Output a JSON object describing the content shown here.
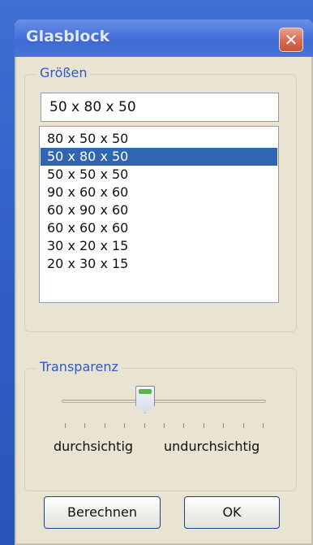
{
  "window": {
    "title": "Glasblock",
    "close_label": "✕"
  },
  "sizes": {
    "legend": "Größen",
    "current_value": "50 x 80 x 50",
    "options": [
      "80 x 50 x 50",
      "50 x 80 x 50",
      "50 x 50 x 50",
      "90 x 60 x 60",
      "60 x 90 x 60",
      "60 x 60 x 60",
      "30 x 20 x 15",
      "20 x 30 x 15"
    ],
    "selected_index": 1
  },
  "transparency": {
    "legend": "Transparenz",
    "min_label": "durchsichtig",
    "max_label": "undurchsichtig",
    "tick_count": 11,
    "value_fraction": 0.4
  },
  "buttons": {
    "calculate": "Berechnen",
    "ok": "OK"
  },
  "colors": {
    "desktop": "#3f6fd3",
    "titlebar": "#4f79dd",
    "selection": "#2f65b1",
    "legend_text": "#2d59c5",
    "window_face": "#e9e3d1"
  }
}
